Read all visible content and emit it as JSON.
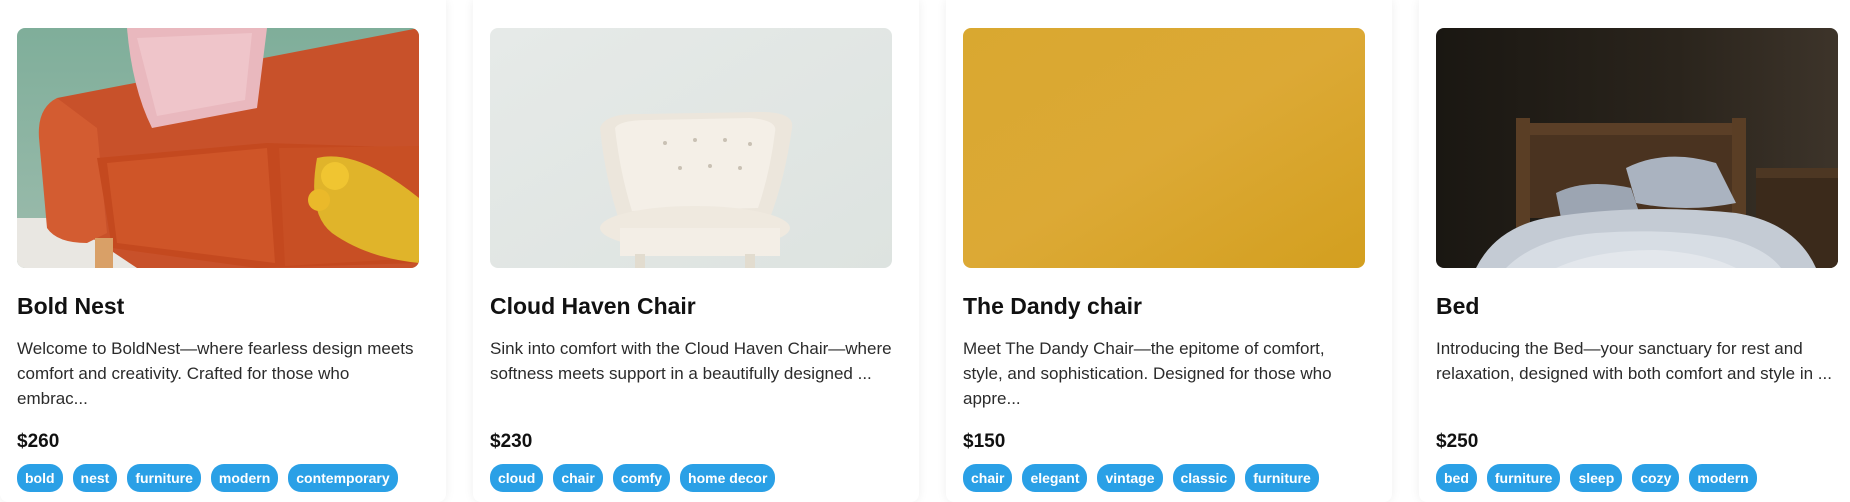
{
  "products": [
    {
      "title": "Bold Nest",
      "description": "Welcome to BoldNest—where fearless design meets comfort and creativity. Crafted for those who embrac...",
      "price": "$260",
      "image": "orange-sofa-image",
      "tags": [
        "bold",
        "nest",
        "furniture",
        "modern",
        "contemporary"
      ]
    },
    {
      "title": "Cloud Haven Chair",
      "description": "Sink into comfort with the Cloud Haven Chair—where softness meets support in a beautifully designed ...",
      "price": "$230",
      "image": "white-armchair-image",
      "tags": [
        "cloud",
        "chair",
        "comfy",
        "home decor"
      ]
    },
    {
      "title": "The Dandy chair",
      "description": "Meet The Dandy Chair—the epitome of comfort, style, and sophistication. Designed for those who appre...",
      "price": "$150",
      "image": "yellow-backdrop-image",
      "tags": [
        "chair",
        "elegant",
        "vintage",
        "classic",
        "furniture"
      ]
    },
    {
      "title": "Bed",
      "description": "Introducing the Bed—your sanctuary for rest and relaxation, designed with both comfort and style in ...",
      "price": "$250",
      "image": "wooden-bed-image",
      "tags": [
        "bed",
        "furniture",
        "sleep",
        "cozy",
        "modern"
      ]
    }
  ],
  "colors": {
    "tag_background": "#2aa0e6",
    "tag_text": "#ffffff"
  }
}
